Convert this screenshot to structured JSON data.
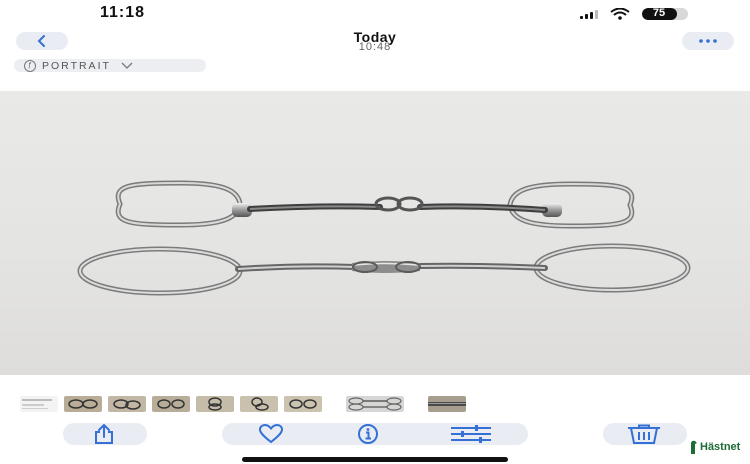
{
  "status_bar": {
    "time": "11:18",
    "battery_level": "75",
    "battery_fraction": 0.75
  },
  "nav": {
    "back_icon": "chevron-left-icon",
    "title": "Today",
    "subtitle": "10:48",
    "more_icon": "more-dots-icon",
    "portrait_label": "PORTRAIT"
  },
  "photo": {
    "subject": "two loose-ring snaffle horse bits on a white table"
  },
  "toolbar": {
    "share_icon": "share-icon",
    "favorite_icon": "heart-icon",
    "info_icon": "info-icon",
    "adjust_icon": "adjust-sliders-icon",
    "delete_icon": "trash-icon",
    "accent_color": "#3470d6"
  },
  "watermark": {
    "text": "Hästnet",
    "color": "#1d6b35"
  }
}
